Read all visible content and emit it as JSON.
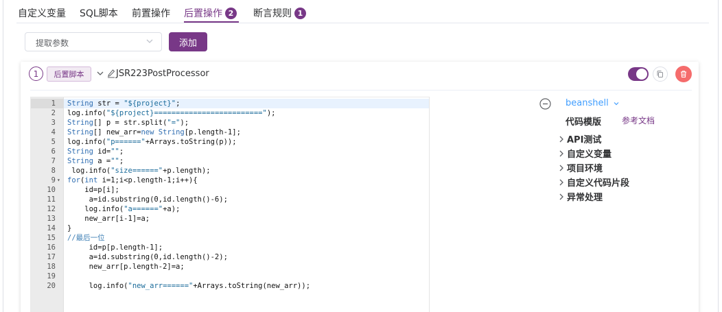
{
  "tabs": [
    {
      "label": "自定义变量"
    },
    {
      "label": "SQL脚本"
    },
    {
      "label": "前置操作"
    },
    {
      "label": "后置操作",
      "badge": "2"
    },
    {
      "label": "断言规则",
      "badge": "1"
    }
  ],
  "extract": {
    "placeholder": "提取参数",
    "add_label": "添加"
  },
  "processor": {
    "index": "1",
    "type_label": "后置脚本",
    "name": "JSR223PostProcessor",
    "enabled": true
  },
  "code": {
    "lines": [
      {
        "n": "1",
        "html": "<span class=\"k\">String</span> str = <span class=\"s\">\"${project}\"</span>;"
      },
      {
        "n": "2",
        "html": "log.info(<span class=\"s\">\"${project}=========================\"</span>);"
      },
      {
        "n": "3",
        "html": "<span class=\"k\">String</span>[] p = str.split(<span class=\"s\">\"=\"</span>);"
      },
      {
        "n": "4",
        "html": "<span class=\"k\">String</span>[] new_arr=<span class=\"k\">new</span> <span class=\"k\">String</span>[p.length-1];"
      },
      {
        "n": "5",
        "html": "log.info(<span class=\"s\">\"p======\"</span>+Arrays.toString(p));"
      },
      {
        "n": "6",
        "html": "<span class=\"k\">String</span> id=<span class=\"s\">\"\"</span>;"
      },
      {
        "n": "7",
        "html": "<span class=\"k\">String</span> a =<span class=\"s\">\"\"</span>;"
      },
      {
        "n": "8",
        "html": " log.info(<span class=\"s\">\"size======\"</span>+p.length);"
      },
      {
        "n": "9",
        "html": "<span class=\"k\">for</span>(<span class=\"k\">int</span> i=1;i&lt;p.length-1;i++){",
        "fold": true
      },
      {
        "n": "10",
        "html": "    id=p[i];"
      },
      {
        "n": "11",
        "html": "     a=id.substring(0,id.length()-6);"
      },
      {
        "n": "12",
        "html": "    log.info(<span class=\"s\">\"a======\"</span>+a);"
      },
      {
        "n": "13",
        "html": "    new_arr[i-1]=a;"
      },
      {
        "n": "14",
        "html": "}"
      },
      {
        "n": "15",
        "html": "<span class=\"c\">//最后一位</span>"
      },
      {
        "n": "16",
        "html": "     id=p[p.length-1];"
      },
      {
        "n": "17",
        "html": "     a=id.substring(0,id.length()-2);"
      },
      {
        "n": "18",
        "html": "     new_arr[p.length-2]=a;"
      },
      {
        "n": "19",
        "html": ""
      },
      {
        "n": "20",
        "html": "     log.info(<span class=\"s\">\"new_arr======\"</span>+Arrays.toString(new_arr));"
      }
    ]
  },
  "panel": {
    "language": "beanshell",
    "template_label": "代码模版",
    "doc_link": "参考文档",
    "tree": [
      {
        "label": "API测试"
      },
      {
        "label": "自定义变量"
      },
      {
        "label": "项目环境"
      },
      {
        "label": "自定义代码片段"
      },
      {
        "label": "异常处理"
      }
    ]
  },
  "colors": {
    "accent": "#783887",
    "danger": "#f56c6c",
    "link": "#409eff"
  }
}
